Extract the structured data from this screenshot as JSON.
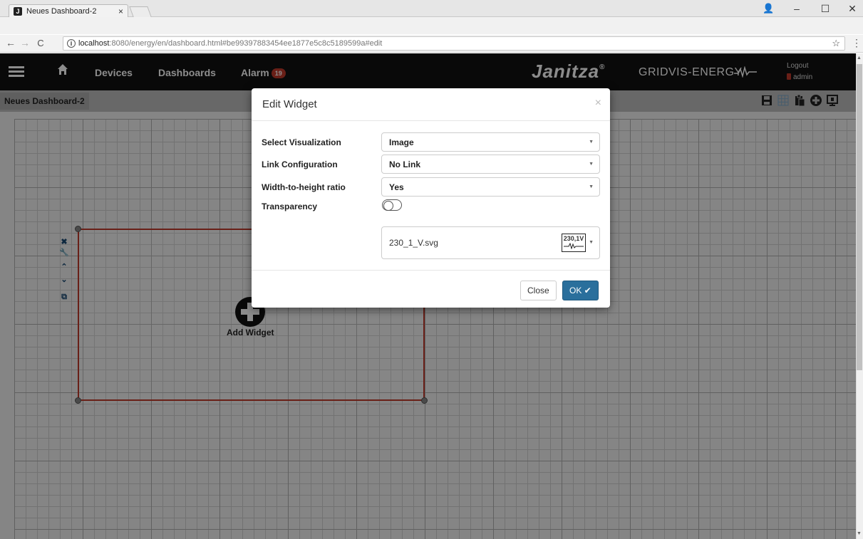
{
  "browser": {
    "tab_title": "Neues Dashboard-2",
    "tab_close": "×",
    "url_host": "localhost",
    "url_rest": ":8080/energy/en/dashboard.html#be99397883454ee1877e5c8c5189599a#edit",
    "win_min": "–",
    "win_max": "☐",
    "win_close": "✕"
  },
  "nav": {
    "devices": "Devices",
    "dashboards": "Dashboards",
    "alarm": "Alarm",
    "alarm_count": "19",
    "brand": "Janitza",
    "brand_reg": "®",
    "brand_sub": "GRIDVIS-ENERGY",
    "logout": "Logout",
    "user": "admin"
  },
  "dashboard": {
    "tab": "Neues Dashboard-2",
    "add_widget": "Add Widget"
  },
  "modal": {
    "title": "Edit Widget",
    "close_x": "×",
    "fields": {
      "visualization_label": "Select Visualization",
      "visualization_value": "Image",
      "link_label": "Link Configuration",
      "link_value": "No Link",
      "ratio_label": "Width-to-height ratio",
      "ratio_value": "Yes",
      "transparency_label": "Transparency",
      "transparency_on": false,
      "image_value": "230_1_V.svg",
      "image_thumb_text": "230,1V"
    },
    "close_button": "Close",
    "ok_button": "OK ✔"
  },
  "colors": {
    "accent": "#2a6f9c",
    "alarm": "#c0392b",
    "widget_border": "#c0392b"
  }
}
